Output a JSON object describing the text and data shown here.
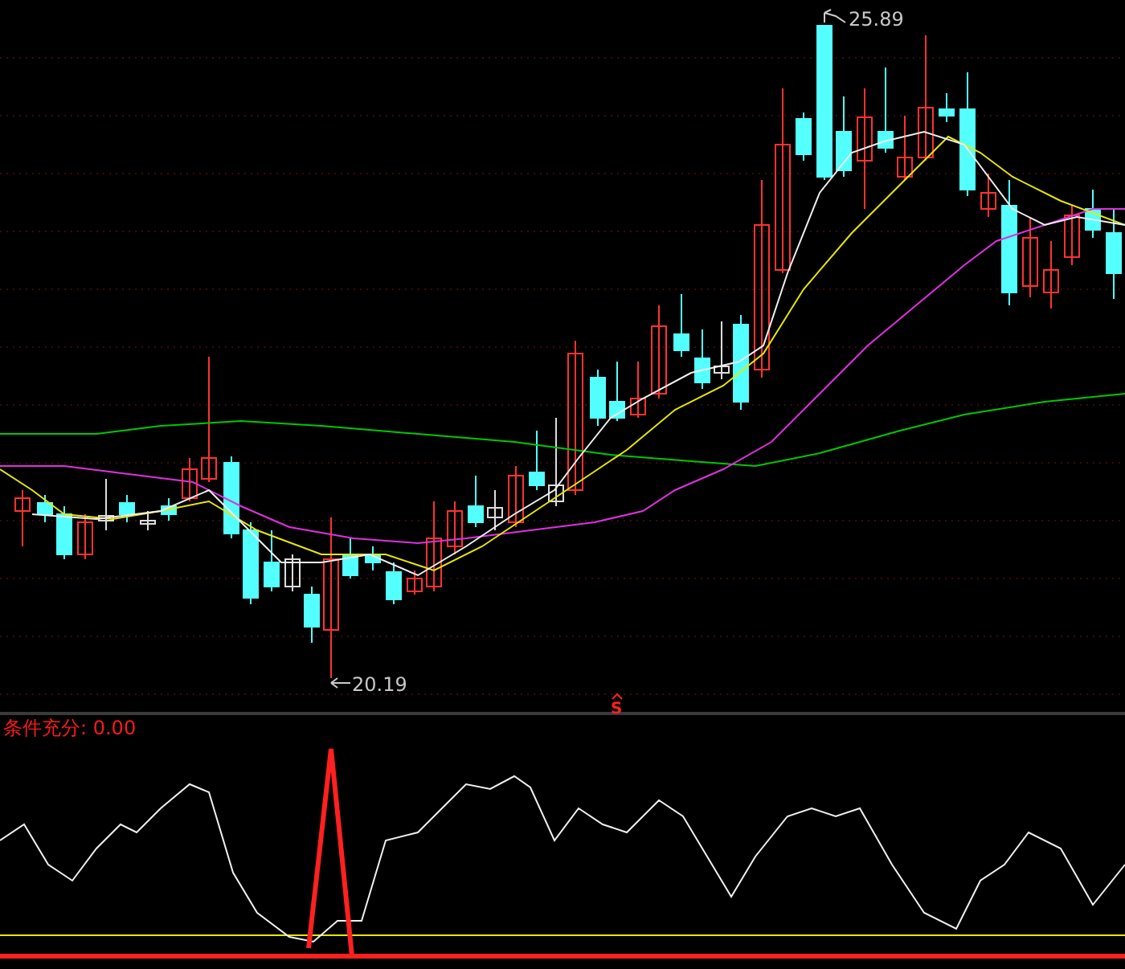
{
  "price_chart": {
    "high_label": "25.89",
    "low_label": "20.19",
    "signal_mark": "S"
  },
  "indicator_panel": {
    "label": "条件充分: 0.00"
  }
}
